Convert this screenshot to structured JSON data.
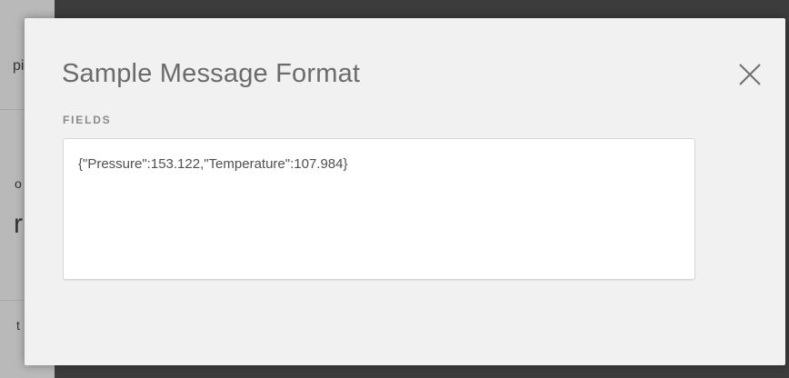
{
  "modal": {
    "title": "Sample Message Format",
    "close_icon": "close-icon",
    "fields_label": "FIELDS",
    "fields_value": "{\"Pressure\":153.122,\"Temperature\":107.984}"
  },
  "colors": {
    "backdrop": "#3c3c3c",
    "modal_background": "#f1f1f1",
    "title": "#6b6b6b",
    "label": "#8a8a8a",
    "text": "#4f4f4f"
  }
}
